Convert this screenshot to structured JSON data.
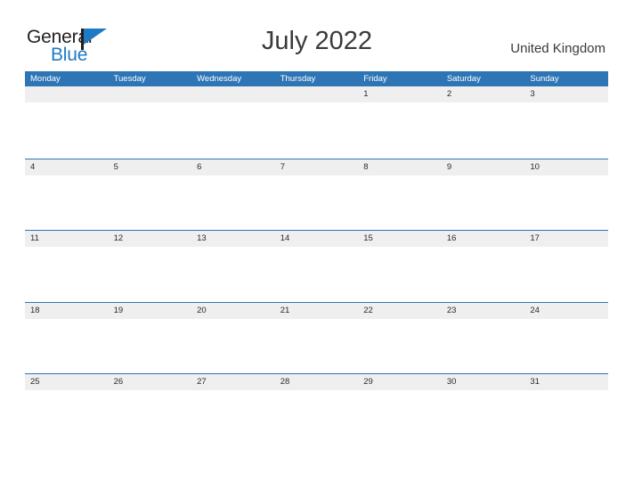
{
  "brand": {
    "name_part1": "General",
    "name_part2": "Blue",
    "logo_icon": "flag-triangle-icon",
    "color_dark": "#231f20",
    "color_blue": "#1f7ac4"
  },
  "header": {
    "title": "July 2022",
    "country": "United Kingdom"
  },
  "calendar": {
    "header_bg": "#2e75b6",
    "row_strip_bg": "#efefef",
    "row_divider": "#2e75b6",
    "weekdays": [
      "Monday",
      "Tuesday",
      "Wednesday",
      "Thursday",
      "Friday",
      "Saturday",
      "Sunday"
    ],
    "weeks": [
      [
        "",
        "",
        "",
        "",
        "1",
        "2",
        "3"
      ],
      [
        "4",
        "5",
        "6",
        "7",
        "8",
        "9",
        "10"
      ],
      [
        "11",
        "12",
        "13",
        "14",
        "15",
        "16",
        "17"
      ],
      [
        "18",
        "19",
        "20",
        "21",
        "22",
        "23",
        "24"
      ],
      [
        "25",
        "26",
        "27",
        "28",
        "29",
        "30",
        "31"
      ]
    ]
  }
}
